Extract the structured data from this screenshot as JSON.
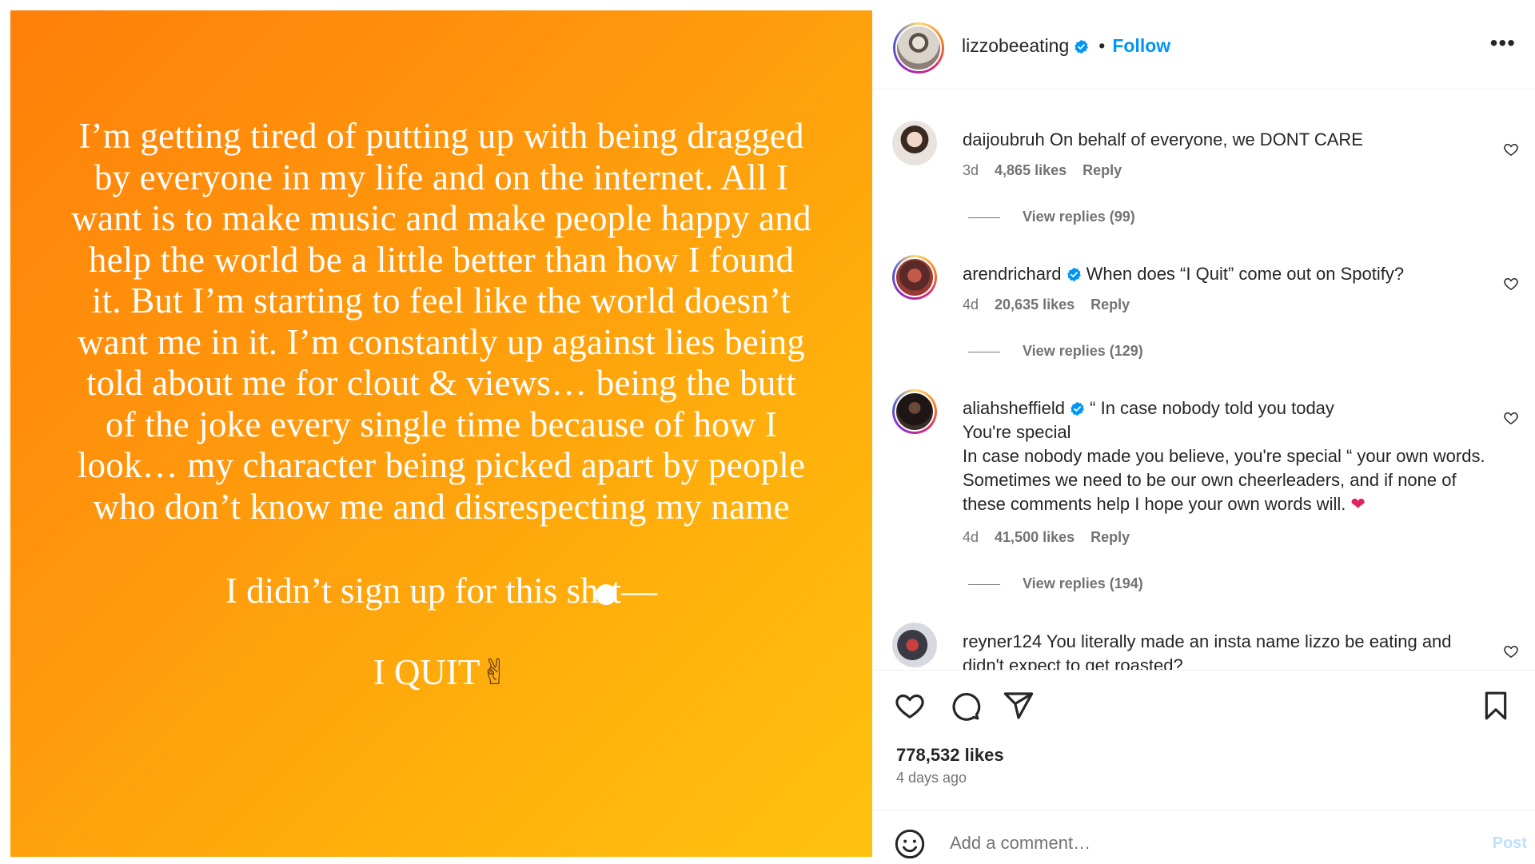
{
  "post": {
    "text_lines": [
      "I’m getting tired of putting up with being dragged",
      "by everyone in my life and on the internet. All I",
      "want is to make music and make people happy and",
      "help the world be a little better than how I found",
      "it. But I’m starting to feel like the world doesn’t",
      "want me in it. I’m constantly up against lies being",
      "told about me for clout & views… being the butt",
      "of the joke every single time because of how I",
      "look… my character being picked apart by people",
      "who don’t know me and disrespecting my name"
    ],
    "sign_before": "I didn’t sign up for this sh",
    "sign_after": "t—",
    "quit": "I QUIT",
    "quit_emoji": "✌",
    "background_colors": [
      "#ff7f0a",
      "#ffc20e"
    ]
  },
  "header": {
    "username": "lizzobeeating",
    "separator": "•",
    "follow_label": "Follow",
    "more_label": "•••"
  },
  "comments": [
    {
      "username": "daijoubruh",
      "text": "On behalf of everyone, we DONT CARE",
      "time": "3d",
      "likes": "4,865 likes",
      "reply_label": "Reply",
      "view_replies": "View replies (99)"
    },
    {
      "username": "arendrichard",
      "verified": true,
      "text": "When does “I Quit” come out on Spotify?",
      "time": "4d",
      "likes": "20,635 likes",
      "reply_label": "Reply",
      "view_replies": "View replies (129)"
    },
    {
      "username": "aliahsheffield",
      "verified": true,
      "text_line1": "“ In case nobody told you today",
      "text_line2": "You're special",
      "text_line3": "In case nobody made you believe, you're special “ your own words. Sometimes we need to be our own cheerleaders, and if none of these comments help I hope your own words will.",
      "emoji": "❤",
      "time": "4d",
      "likes": "41,500 likes",
      "reply_label": "Reply",
      "view_replies": "View replies (194)"
    },
    {
      "username": "reyner124",
      "text": "You literally made an insta name lizzo be eating and didn't expect to get roasted?"
    }
  ],
  "actions": {
    "likes": "778,532 likes",
    "time_ago": "4 days ago"
  },
  "add_comment": {
    "placeholder": "Add a comment…",
    "post_label": "Post"
  },
  "colors": {
    "accent": "#0095f6",
    "muted": "#737373",
    "text": "#262626"
  }
}
